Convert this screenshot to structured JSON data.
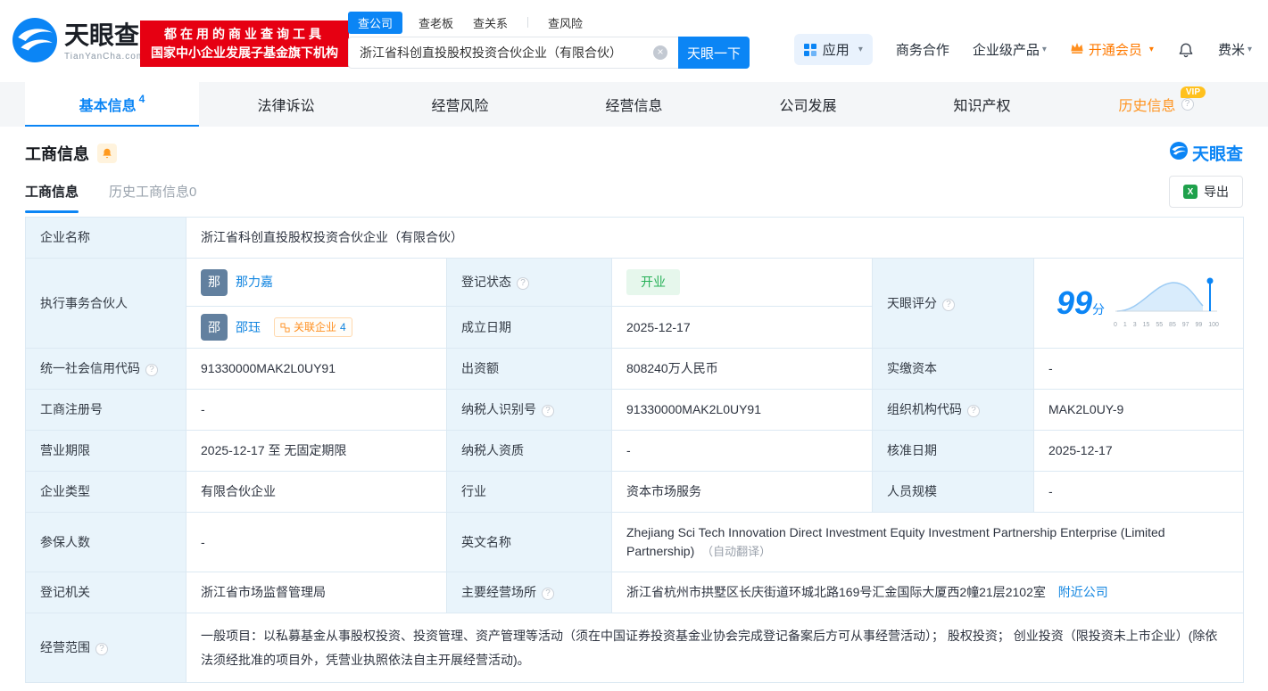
{
  "icons": {
    "question": "?",
    "clear": "×",
    "caret": "▾",
    "excel": "X"
  },
  "brand": {
    "name": "天眼查",
    "domain": "TianYanCha.com",
    "slogan_line1": "都在用的商业查询工具",
    "slogan_line2": "国家中小企业发展子基金旗下机构"
  },
  "search": {
    "tabs": [
      {
        "label": "查公司",
        "active": true
      },
      {
        "label": "查老板",
        "active": false
      },
      {
        "label": "查关系",
        "active": false
      },
      {
        "label": "查风险",
        "active": false
      }
    ],
    "value": "浙江省科创直投股权投资合伙企业（有限合伙）",
    "button_label": "天眼一下"
  },
  "top_menu": {
    "apps": "应用",
    "cooperation": "商务合作",
    "enterprise_products": "企业级产品",
    "vip": "开通会员",
    "user": "费米"
  },
  "main_tabs": [
    {
      "label": "基本信息",
      "count": "4",
      "active": true
    },
    {
      "label": "法律诉讼"
    },
    {
      "label": "经营风险"
    },
    {
      "label": "经营信息"
    },
    {
      "label": "公司发展"
    },
    {
      "label": "知识产权"
    },
    {
      "label": "历史信息",
      "vip": "VIP"
    }
  ],
  "section": {
    "title": "工商信息",
    "watermark_brand": "天眼查"
  },
  "sub_tabs": [
    {
      "label": "工商信息",
      "active": true
    },
    {
      "label": "历史工商信息",
      "count": "0"
    }
  ],
  "export_label": "导出",
  "table": {
    "company_name_label": "企业名称",
    "company_name": "浙江省科创直投股权投资合伙企业（有限合伙）",
    "partner_label": "执行事务合伙人",
    "partners": [
      {
        "avatar": "那",
        "name": "那力嘉"
      },
      {
        "avatar": "邵",
        "name": "邵珏"
      }
    ],
    "related_badge": {
      "label": "关联企业",
      "count": "4"
    },
    "reg_status_label": "登记状态",
    "reg_status": "开业",
    "establish_label": "成立日期",
    "establish_date": "2025-12-17",
    "score_label": "天眼评分",
    "score_value": "99",
    "score_unit": "分",
    "score_axis": [
      "0",
      "1",
      "3",
      "15",
      "55",
      "85",
      "97",
      "99",
      "100"
    ],
    "credit_code_label": "统一社会信用代码",
    "credit_code": "91330000MAK2L0UY91",
    "capital_label": "出资额",
    "capital": "808240万人民币",
    "paid_capital_label": "实缴资本",
    "paid_capital": "-",
    "reg_number_label": "工商注册号",
    "reg_number": "-",
    "taxpayer_id_label": "纳税人识别号",
    "taxpayer_id": "91330000MAK2L0UY91",
    "org_code_label": "组织机构代码",
    "org_code": "MAK2L0UY-9",
    "business_term_label": "营业期限",
    "business_term": "2025-12-17 至 无固定期限",
    "taxpayer_quality_label": "纳税人资质",
    "taxpayer_quality": "-",
    "approval_date_label": "核准日期",
    "approval_date": "2025-12-17",
    "company_type_label": "企业类型",
    "company_type": "有限合伙企业",
    "industry_label": "行业",
    "industry": "资本市场服务",
    "staff_size_label": "人员规模",
    "staff_size": "-",
    "insured_label": "参保人数",
    "insured": "-",
    "english_name_label": "英文名称",
    "english_name": "Zhejiang Sci Tech Innovation Direct Investment Equity Investment Partnership Enterprise (Limited Partnership)",
    "english_name_note": "（自动翻译）",
    "reg_authority_label": "登记机关",
    "reg_authority": "浙江省市场监督管理局",
    "address_label": "主要经营场所",
    "address": "浙江省杭州市拱墅区长庆街道环城北路169号汇金国际大厦西2幢21层2102室",
    "nearby_link": "附近公司",
    "scope_label": "经营范围",
    "scope": "一般项目：以私募基金从事股权投资、投资管理、资产管理等活动（须在中国证券投资基金业协会完成登记备案后方可从事经营活动）； 股权投资； 创业投资（限投资未上市企业）(除依法须经批准的项目外，凭营业执照依法自主开展经营活动)。"
  }
}
